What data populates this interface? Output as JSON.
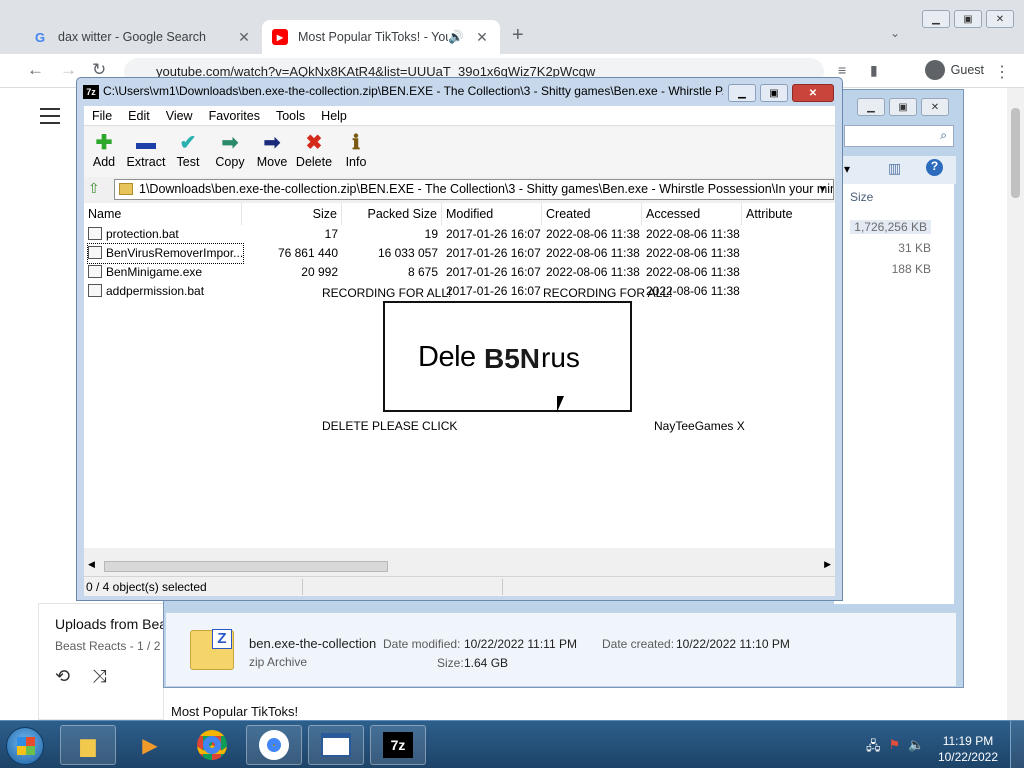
{
  "chrome": {
    "tabs": [
      {
        "title": "dax witter - Google Search",
        "favicon": "G",
        "active": false
      },
      {
        "title": "Most Popular TikToks! - YouT",
        "favicon": "▶",
        "active": true
      }
    ],
    "new_tab": "+",
    "url": "youtube.com/watch?v=AQkNx8KAtR4&list=UUUaT_39o1x6qWiz7K2pWcqw",
    "profile_name": "Guest",
    "yt_uploads_title": "Uploads from Bea",
    "yt_uploads_sub": "Beast Reacts - 1 / 2",
    "yt_video_title": "Most Popular TikToks!"
  },
  "explorer": {
    "size_header": "Size",
    "sizes": [
      "1,726,256 KB",
      "31 KB",
      "188 KB"
    ],
    "details": {
      "name": "ben.exe-the-collection",
      "type": "zip Archive",
      "date_modified_label": "Date modified:",
      "date_modified": "10/22/2022 11:11 PM",
      "date_created_label": "Date created:",
      "date_created": "10/22/2022 11:10 PM",
      "size_label": "Size:",
      "size": "1.64 GB"
    }
  },
  "sevenzip": {
    "title": "C:\\Users\\vm1\\Downloads\\ben.exe-the-collection.zip\\BEN.EXE - The Collection\\3 - Shitty games\\Ben.exe - Whirstle P...",
    "menu": [
      "File",
      "Edit",
      "View",
      "Favorites",
      "Tools",
      "Help"
    ],
    "toolbar": [
      {
        "label": "Add",
        "icon": "plus-icon",
        "glyph": "✚",
        "color": "#2ca82c"
      },
      {
        "label": "Extract",
        "icon": "minus-icon",
        "glyph": "▬",
        "color": "#1d3fa8"
      },
      {
        "label": "Test",
        "icon": "check-icon",
        "glyph": "✔",
        "color": "#2ab0b0"
      },
      {
        "label": "Copy",
        "icon": "copy-arrow-icon",
        "glyph": "➡",
        "color": "#2a8a6a"
      },
      {
        "label": "Move",
        "icon": "move-arrow-icon",
        "glyph": "➡",
        "color": "#1b2a7a"
      },
      {
        "label": "Delete",
        "icon": "delete-x-icon",
        "glyph": "✖",
        "color": "#d42a1c"
      },
      {
        "label": "Info",
        "icon": "info-icon",
        "glyph": "ℹ",
        "color": "#7a5a10"
      }
    ],
    "address": "1\\Downloads\\ben.exe-the-collection.zip\\BEN.EXE - The Collection\\3 - Shitty games\\Ben.exe - Whirstle Possession\\In your mind\\",
    "columns": [
      "Name",
      "Size",
      "Packed Size",
      "Modified",
      "Created",
      "Accessed",
      "Attribute"
    ],
    "files": [
      {
        "name": "protection.bat",
        "size": "17",
        "packed": "19",
        "modified": "2017-01-26 16:07",
        "created": "2022-08-06 11:38",
        "accessed": "2022-08-06 11:38"
      },
      {
        "name": "BenVirusRemoverImpor...",
        "size": "76 861 440",
        "packed": "16 033 057",
        "modified": "2017-01-26 16:07",
        "created": "2022-08-06 11:38",
        "accessed": "2022-08-06 11:38"
      },
      {
        "name": "BenMinigame.exe",
        "size": "20 992",
        "packed": "8 675",
        "modified": "2017-01-26 16:07",
        "created": "2022-08-06 11:38",
        "accessed": "2022-08-06 11:38"
      },
      {
        "name": "addpermission.bat",
        "size": "",
        "packed": "",
        "modified": "2017-01-26 16:07",
        "created": "",
        "accessed": "2022-08-06 11:38"
      }
    ],
    "status": "0 / 4 object(s) selected"
  },
  "overlay": {
    "recording1": "RECORDING FOR ALL!",
    "recording2": "RECORDING FOR ALL!",
    "box_a": "Dele",
    "box_b": "B5N",
    "box_c": "rus",
    "delete_click": "DELETE PLEASE CLICK",
    "naytee": "NayTeeGames X"
  },
  "taskbar": {
    "time": "11:19 PM",
    "date": "10/22/2022",
    "apps": [
      "explorer",
      "media",
      "chrome",
      "chrome",
      "window",
      "7z"
    ]
  }
}
